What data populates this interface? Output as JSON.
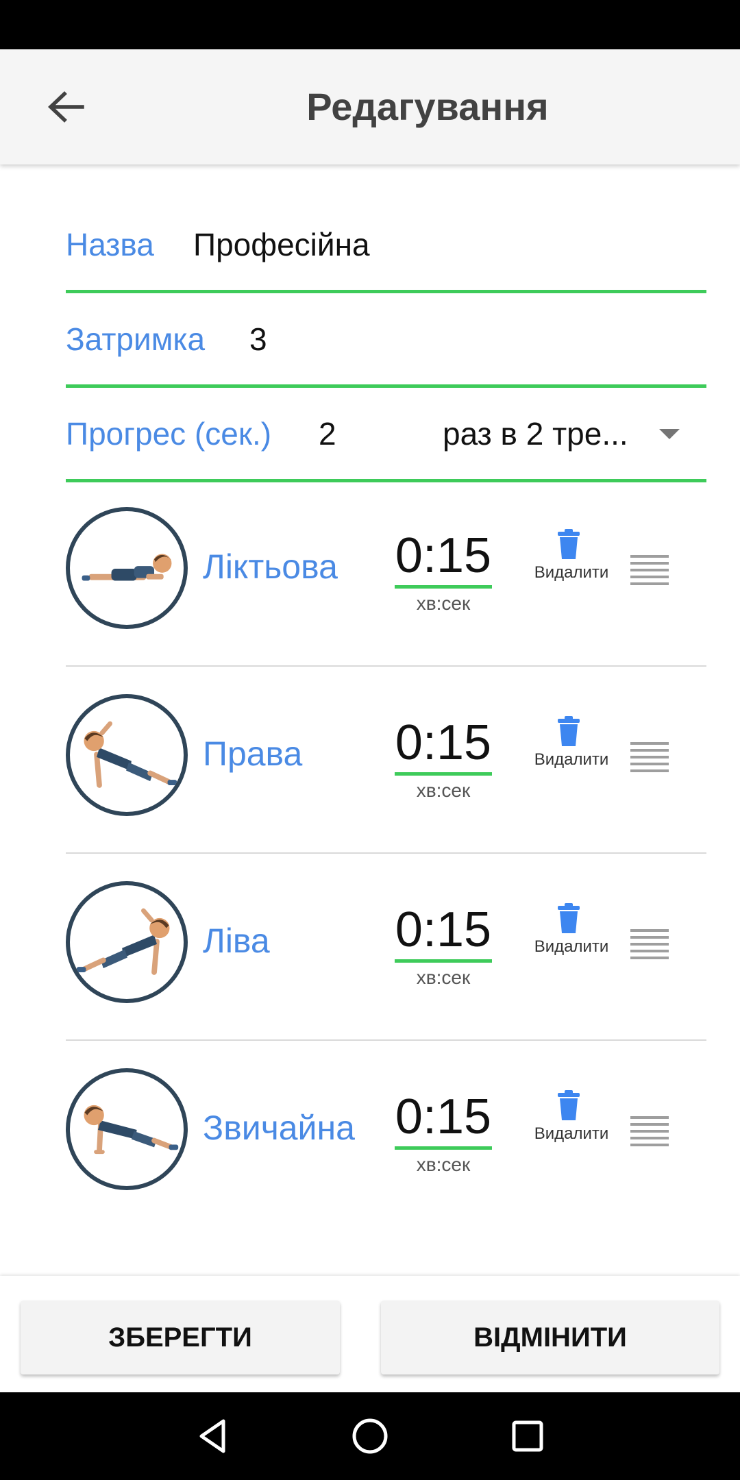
{
  "app_bar": {
    "title": "Редагування",
    "back_icon": "arrow-back-icon"
  },
  "form": {
    "name": {
      "label": "Назва",
      "value": "Професійна"
    },
    "delay": {
      "label": "Затримка",
      "value": "3"
    },
    "progress": {
      "label": "Прогрес (сек.)",
      "value": "2",
      "frequency_selected": "раз в 2 тре..."
    }
  },
  "exercises": [
    {
      "name": "Ліктьова",
      "time": "0:15",
      "unit": "хв:сек",
      "delete_label": "Видалити",
      "image": "elbow-plank-figure"
    },
    {
      "name": "Права",
      "time": "0:15",
      "unit": "хв:сек",
      "delete_label": "Видалити",
      "image": "right-side-plank-figure"
    },
    {
      "name": "Ліва",
      "time": "0:15",
      "unit": "хв:сек",
      "delete_label": "Видалити",
      "image": "left-side-plank-figure"
    },
    {
      "name": "Звичайна",
      "time": "0:15",
      "unit": "хв:сек",
      "delete_label": "Видалити",
      "image": "straight-arm-plank-figure"
    }
  ],
  "buttons": {
    "save": "ЗБЕРЕГТИ",
    "cancel": "ВІДМІНИТИ"
  },
  "colors": {
    "accent_blue": "#4a8ae4",
    "underline_green": "#3ecb5a",
    "circle_border": "#2f4558"
  }
}
